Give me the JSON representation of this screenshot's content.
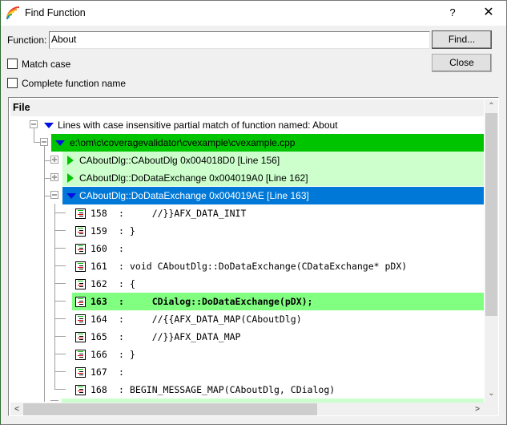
{
  "window": {
    "title": "Find Function",
    "help_label": "?",
    "close_label": "✕",
    "app_icon": "rainbow-arcs-icon"
  },
  "form": {
    "function_label": "Function:",
    "function_value": "About",
    "find_label": "Find...",
    "close_label": "Close",
    "match_case_label": "Match case",
    "match_case_checked": false,
    "complete_name_label": "Complete function name",
    "complete_name_checked": false
  },
  "colors": {
    "file_row_bg": "#00c400",
    "function_row_bg": "#ccffcc",
    "selected_row_bg": "#0078d7",
    "matched_line_bg": "#80ff80"
  },
  "tree": {
    "column_header": "File",
    "nodes": [
      {
        "text": "Lines with case insensitive partial match of function named: About",
        "expanded": true
      },
      {
        "text": "e:\\om\\c\\coveragevalidator\\cvexample\\cvexample.cpp",
        "expanded": true
      },
      {
        "text": "CAboutDlg::CAboutDlg 0x004018D0 [Line 156]",
        "expanded": false
      },
      {
        "text": "CAboutDlg::DoDataExchange 0x004019A0 [Line 162]",
        "expanded": false
      },
      {
        "text": "CAboutDlg::DoDataExchange 0x004019AE [Line 163]",
        "expanded": true,
        "selected": true
      }
    ],
    "code_lines": [
      {
        "num": "158",
        "sep": ":",
        "code": "    //}}AFX_DATA_INIT"
      },
      {
        "num": "159",
        "sep": ":",
        "code": "}"
      },
      {
        "num": "160",
        "sep": ":",
        "code": ""
      },
      {
        "num": "161",
        "sep": ":",
        "code": "void CAboutDlg::DoDataExchange(CDataExchange* pDX)"
      },
      {
        "num": "162",
        "sep": ":",
        "code": "{"
      },
      {
        "num": "163",
        "sep": ":",
        "code": "    CDialog::DoDataExchange(pDX);",
        "highlight": true
      },
      {
        "num": "164",
        "sep": ":",
        "code": "    //{{AFX_DATA_MAP(CAboutDlg)"
      },
      {
        "num": "165",
        "sep": ":",
        "code": "    //}}AFX_DATA_MAP"
      },
      {
        "num": "166",
        "sep": ":",
        "code": "}"
      },
      {
        "num": "167",
        "sep": ":",
        "code": ""
      },
      {
        "num": "168",
        "sep": ":",
        "code": "BEGIN_MESSAGE_MAP(CAboutDlg, CDialog)"
      }
    ]
  },
  "scrollbars": {
    "up": "⌃",
    "down": "⌄",
    "left": "<",
    "right": ">"
  }
}
